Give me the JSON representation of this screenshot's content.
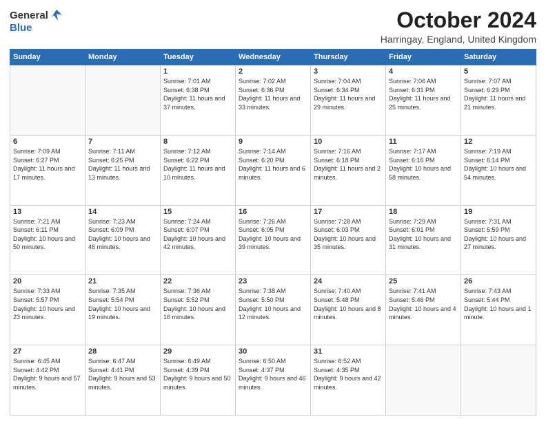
{
  "header": {
    "logo_general": "General",
    "logo_blue": "Blue",
    "month": "October 2024",
    "location": "Harringay, England, United Kingdom"
  },
  "weekdays": [
    "Sunday",
    "Monday",
    "Tuesday",
    "Wednesday",
    "Thursday",
    "Friday",
    "Saturday"
  ],
  "weeks": [
    [
      {
        "day": "",
        "info": ""
      },
      {
        "day": "",
        "info": ""
      },
      {
        "day": "1",
        "info": "Sunrise: 7:01 AM\nSunset: 6:38 PM\nDaylight: 11 hours and 37 minutes."
      },
      {
        "day": "2",
        "info": "Sunrise: 7:02 AM\nSunset: 6:36 PM\nDaylight: 11 hours and 33 minutes."
      },
      {
        "day": "3",
        "info": "Sunrise: 7:04 AM\nSunset: 6:34 PM\nDaylight: 11 hours and 29 minutes."
      },
      {
        "day": "4",
        "info": "Sunrise: 7:06 AM\nSunset: 6:31 PM\nDaylight: 11 hours and 25 minutes."
      },
      {
        "day": "5",
        "info": "Sunrise: 7:07 AM\nSunset: 6:29 PM\nDaylight: 11 hours and 21 minutes."
      }
    ],
    [
      {
        "day": "6",
        "info": "Sunrise: 7:09 AM\nSunset: 6:27 PM\nDaylight: 11 hours and 17 minutes."
      },
      {
        "day": "7",
        "info": "Sunrise: 7:11 AM\nSunset: 6:25 PM\nDaylight: 11 hours and 13 minutes."
      },
      {
        "day": "8",
        "info": "Sunrise: 7:12 AM\nSunset: 6:22 PM\nDaylight: 11 hours and 10 minutes."
      },
      {
        "day": "9",
        "info": "Sunrise: 7:14 AM\nSunset: 6:20 PM\nDaylight: 11 hours and 6 minutes."
      },
      {
        "day": "10",
        "info": "Sunrise: 7:16 AM\nSunset: 6:18 PM\nDaylight: 11 hours and 2 minutes."
      },
      {
        "day": "11",
        "info": "Sunrise: 7:17 AM\nSunset: 6:16 PM\nDaylight: 10 hours and 58 minutes."
      },
      {
        "day": "12",
        "info": "Sunrise: 7:19 AM\nSunset: 6:14 PM\nDaylight: 10 hours and 54 minutes."
      }
    ],
    [
      {
        "day": "13",
        "info": "Sunrise: 7:21 AM\nSunset: 6:11 PM\nDaylight: 10 hours and 50 minutes."
      },
      {
        "day": "14",
        "info": "Sunrise: 7:23 AM\nSunset: 6:09 PM\nDaylight: 10 hours and 46 minutes."
      },
      {
        "day": "15",
        "info": "Sunrise: 7:24 AM\nSunset: 6:07 PM\nDaylight: 10 hours and 42 minutes."
      },
      {
        "day": "16",
        "info": "Sunrise: 7:26 AM\nSunset: 6:05 PM\nDaylight: 10 hours and 39 minutes."
      },
      {
        "day": "17",
        "info": "Sunrise: 7:28 AM\nSunset: 6:03 PM\nDaylight: 10 hours and 35 minutes."
      },
      {
        "day": "18",
        "info": "Sunrise: 7:29 AM\nSunset: 6:01 PM\nDaylight: 10 hours and 31 minutes."
      },
      {
        "day": "19",
        "info": "Sunrise: 7:31 AM\nSunset: 5:59 PM\nDaylight: 10 hours and 27 minutes."
      }
    ],
    [
      {
        "day": "20",
        "info": "Sunrise: 7:33 AM\nSunset: 5:57 PM\nDaylight: 10 hours and 23 minutes."
      },
      {
        "day": "21",
        "info": "Sunrise: 7:35 AM\nSunset: 5:54 PM\nDaylight: 10 hours and 19 minutes."
      },
      {
        "day": "22",
        "info": "Sunrise: 7:36 AM\nSunset: 5:52 PM\nDaylight: 10 hours and 16 minutes."
      },
      {
        "day": "23",
        "info": "Sunrise: 7:38 AM\nSunset: 5:50 PM\nDaylight: 10 hours and 12 minutes."
      },
      {
        "day": "24",
        "info": "Sunrise: 7:40 AM\nSunset: 5:48 PM\nDaylight: 10 hours and 8 minutes."
      },
      {
        "day": "25",
        "info": "Sunrise: 7:41 AM\nSunset: 5:46 PM\nDaylight: 10 hours and 4 minutes."
      },
      {
        "day": "26",
        "info": "Sunrise: 7:43 AM\nSunset: 5:44 PM\nDaylight: 10 hours and 1 minute."
      }
    ],
    [
      {
        "day": "27",
        "info": "Sunrise: 6:45 AM\nSunset: 4:42 PM\nDaylight: 9 hours and 57 minutes."
      },
      {
        "day": "28",
        "info": "Sunrise: 6:47 AM\nSunset: 4:41 PM\nDaylight: 9 hours and 53 minutes."
      },
      {
        "day": "29",
        "info": "Sunrise: 6:49 AM\nSunset: 4:39 PM\nDaylight: 9 hours and 50 minutes."
      },
      {
        "day": "30",
        "info": "Sunrise: 6:50 AM\nSunset: 4:37 PM\nDaylight: 9 hours and 46 minutes."
      },
      {
        "day": "31",
        "info": "Sunrise: 6:52 AM\nSunset: 4:35 PM\nDaylight: 9 hours and 42 minutes."
      },
      {
        "day": "",
        "info": ""
      },
      {
        "day": "",
        "info": ""
      }
    ]
  ]
}
